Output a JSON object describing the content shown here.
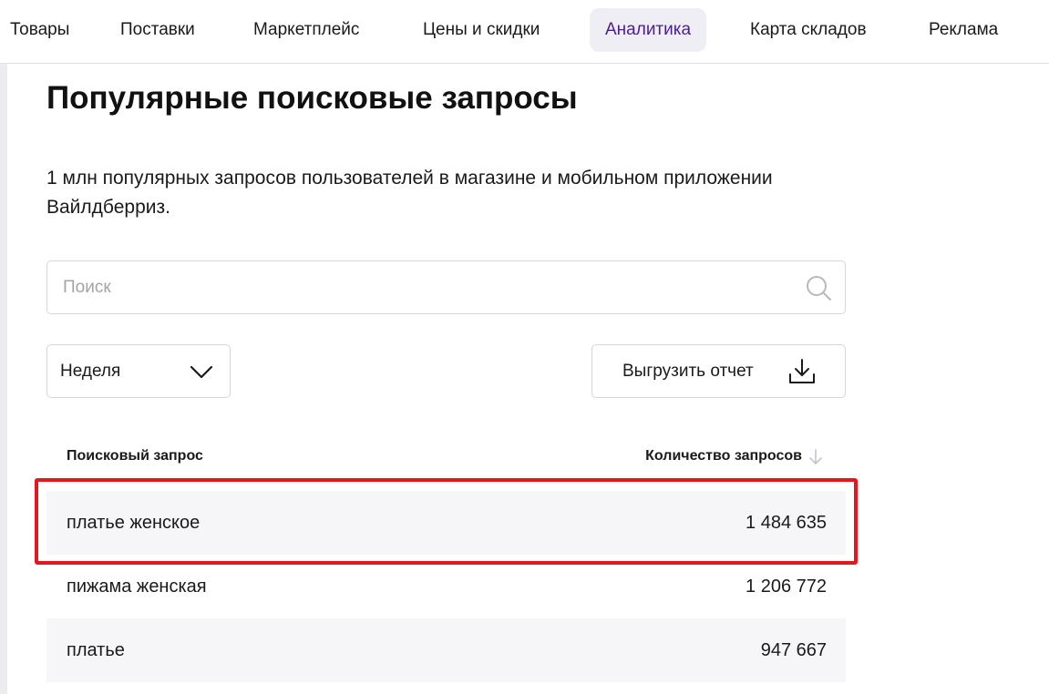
{
  "nav": {
    "tabs": [
      {
        "label": "Товары"
      },
      {
        "label": "Поставки"
      },
      {
        "label": "Маркетплейс"
      },
      {
        "label": "Цены и скидки"
      },
      {
        "label": "Аналитика",
        "active": true
      },
      {
        "label": "Карта складов"
      },
      {
        "label": "Реклама"
      }
    ]
  },
  "page": {
    "title": "Популярные поисковые запросы",
    "description": "1 млн популярных запросов пользователей в магазине и мобильном приложении Вайлдберриз."
  },
  "search": {
    "placeholder": "Поиск",
    "value": ""
  },
  "period_select": {
    "value": "Неделя"
  },
  "export_button": {
    "label": "Выгрузить отчет"
  },
  "table": {
    "columns": {
      "query": "Поисковый запрос",
      "count": "Количество запросов"
    },
    "rows": [
      {
        "query": "платье женское",
        "count": "1 484 635"
      },
      {
        "query": "пижама женская",
        "count": "1 206 772"
      },
      {
        "query": "платье",
        "count": "947 667"
      }
    ]
  },
  "colors": {
    "active_tab_bg": "#f0eef5",
    "active_tab_text": "#4b1e90",
    "highlight_border": "#e5161e",
    "row_shade": "#f6f6f9"
  },
  "icons": {
    "search": "search-icon",
    "select": "chevron-down-icon",
    "export": "download-icon",
    "sort": "arrow-down-icon"
  }
}
